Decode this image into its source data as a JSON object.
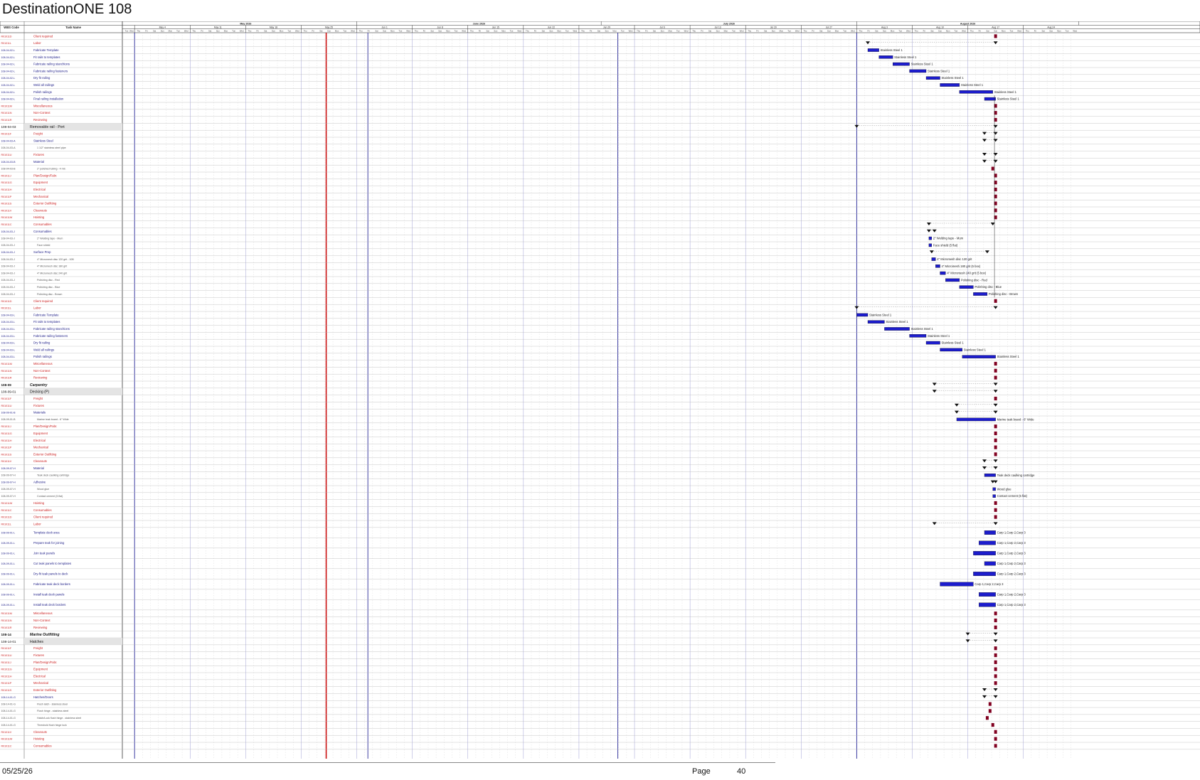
{
  "document": {
    "title": "DestinationONE 108",
    "footer_date": "05/25/26",
    "page_label": "Page",
    "page_number": "40"
  },
  "columns": {
    "wbs": "WBS Code",
    "task": "Task Name"
  },
  "timescale": {
    "months": [
      "May 2026",
      "June 2026",
      "July 2026",
      "August 2026"
    ],
    "weeks": [
      "May 4",
      "May 11",
      "May 18",
      "May 25",
      "Jun 1",
      "Jun 8",
      "Jun 15",
      "Jun 22",
      "Jun 29",
      "Jul 6",
      "Jul 13",
      "Jul 20",
      "Jul 27",
      "Aug 3",
      "Aug 10",
      "Aug 17",
      "Aug 24"
    ],
    "days": [
      "Thu",
      "Fri",
      "Sat",
      "Sun",
      "Mon",
      "Tue",
      "Wed"
    ],
    "today_week_index": 3.45,
    "bar_color": "#1c1ccc",
    "milestone_color": "#800020",
    "text_red": "#cc2222",
    "text_blue": "#22228a"
  },
  "rows": [
    {
      "wbs": "R01011D",
      "name": "Client required",
      "cls": "r",
      "ind": 1,
      "t": "mile",
      "at": 15.5
    },
    {
      "wbs": "R01011L",
      "name": "Labor",
      "cls": "r",
      "ind": 1,
      "t": "sum",
      "s": 13.2,
      "e": 15.5
    },
    {
      "wbs": "108-04-02-L",
      "name": "Fabricate Template",
      "cls": "b",
      "ind": 1,
      "t": "bar",
      "s": 13.2,
      "e": 13.4,
      "lbl": "Stainless Steel 1"
    },
    {
      "wbs": "108-04-02-L",
      "name": "Fit rails to templates",
      "cls": "b",
      "ind": 1,
      "t": "bar",
      "s": 13.4,
      "e": 13.65,
      "lbl": "Stainless Steel 1"
    },
    {
      "wbs": "108-04-02-L",
      "name": "Fabricate railing stanchions",
      "cls": "b",
      "ind": 1,
      "t": "bar",
      "s": 13.65,
      "e": 13.95,
      "lbl": "Stainless Steel 1"
    },
    {
      "wbs": "108-04-02-L",
      "name": "Fabricate railing fasteners",
      "cls": "b",
      "ind": 1,
      "t": "bar",
      "s": 13.95,
      "e": 14.25,
      "lbl": "Stainless Steel 1"
    },
    {
      "wbs": "108-04-02-L",
      "name": "Dry fit railing",
      "cls": "b",
      "ind": 1,
      "t": "bar",
      "s": 14.25,
      "e": 14.5,
      "lbl": "Stainless Steel 1"
    },
    {
      "wbs": "108-04-02-L",
      "name": "Weld all railings",
      "cls": "b",
      "ind": 1,
      "t": "bar",
      "s": 14.5,
      "e": 14.85,
      "lbl": "Stainless Steel 1"
    },
    {
      "wbs": "108-04-02-L",
      "name": "Polish railings",
      "cls": "b",
      "ind": 1,
      "t": "bar",
      "s": 14.85,
      "e": 15.45,
      "lbl": "Stainless Steel 1"
    },
    {
      "wbs": "108-04-02-L",
      "name": "Final railing installation",
      "cls": "b",
      "ind": 1,
      "t": "bar",
      "s": 15.3,
      "e": 15.5,
      "lbl": "Stainless Steel 1"
    },
    {
      "wbs": "R01011M",
      "name": "Miscellaneous",
      "cls": "r",
      "ind": 1,
      "t": "mile",
      "at": 15.5
    },
    {
      "wbs": "R01011N",
      "name": "Non-Context",
      "cls": "r",
      "ind": 1,
      "t": "mile",
      "at": 15.5
    },
    {
      "wbs": "R01011R",
      "name": "Reviewing",
      "cls": "r",
      "ind": 1,
      "t": "mile",
      "at": 15.5
    },
    {
      "wbs": "108-04-03",
      "name": "Removable rail - Port",
      "cls": "h",
      "ind": 0,
      "t": "sum",
      "s": 13.0,
      "e": 15.5
    },
    {
      "wbs": "R01011F",
      "name": "Freight",
      "cls": "r",
      "ind": 1,
      "t": "sum",
      "s": 15.3,
      "e": 15.5
    },
    {
      "wbs": "108-04-03-A",
      "name": "Stainless Steel",
      "cls": "b",
      "ind": 1,
      "t": "sum",
      "s": 15.3,
      "e": 15.5
    },
    {
      "wbs": "108-04-03-A",
      "name": "1 1/2\" stainless steel pipe",
      "cls": "g",
      "ind": 2,
      "t": "none"
    },
    {
      "wbs": "R01011U",
      "name": "Fixtures",
      "cls": "r",
      "ind": 1,
      "t": "sum",
      "s": 15.3,
      "e": 15.5
    },
    {
      "wbs": "108-04-03-B",
      "name": "Material",
      "cls": "b",
      "ind": 1,
      "t": "sum",
      "s": 15.3,
      "e": 15.5
    },
    {
      "wbs": "108-04-03-B",
      "name": "2\" polished tubing - 4 mtr.",
      "cls": "g",
      "ind": 2,
      "t": "mile",
      "at": 15.45
    },
    {
      "wbs": "R01011J",
      "name": "Plan/Design/Fabr.",
      "cls": "r",
      "ind": 1,
      "t": "mile",
      "at": 15.5
    },
    {
      "wbs": "R01011G",
      "name": "Equipment",
      "cls": "r",
      "ind": 1,
      "t": "mile",
      "at": 15.5
    },
    {
      "wbs": "R01011H",
      "name": "Electrical",
      "cls": "r",
      "ind": 1,
      "t": "mile",
      "at": 15.5
    },
    {
      "wbs": "R01011P",
      "name": "Mechanical",
      "cls": "r",
      "ind": 1,
      "t": "mile",
      "at": 15.5
    },
    {
      "wbs": "R01011S",
      "name": "Exterior Outfitting",
      "cls": "r",
      "ind": 1,
      "t": "mile",
      "at": 15.5
    },
    {
      "wbs": "R01011V",
      "name": "Cleanouts",
      "cls": "r",
      "ind": 1,
      "t": "mile",
      "at": 15.5
    },
    {
      "wbs": "R01011W",
      "name": "Hoisting",
      "cls": "r",
      "ind": 1,
      "t": "mile",
      "at": 15.5
    },
    {
      "wbs": "R01011C",
      "name": "Consumables",
      "cls": "r",
      "ind": 1,
      "t": "sum",
      "s": 14.3,
      "e": 15.45
    },
    {
      "wbs": "108-04-03-J",
      "name": "Consumables",
      "cls": "b",
      "ind": 1,
      "t": "sum",
      "s": 14.3,
      "e": 14.4
    },
    {
      "wbs": "108-04-03-J",
      "name": "2\" Welding tape - Mum",
      "cls": "g",
      "ind": 2,
      "t": "bar",
      "s": 14.3,
      "e": 14.35,
      "lbl": "2\" Welding tape - Mum"
    },
    {
      "wbs": "108-04-03-J",
      "name": "Face shield",
      "cls": "g",
      "ind": 2,
      "t": "bar",
      "s": 14.3,
      "e": 14.35,
      "lbl": "Face shield (5 flat)"
    },
    {
      "wbs": "108-04-03-J",
      "name": "Surface Prep",
      "cls": "b",
      "ind": 1,
      "t": "sum",
      "s": 14.35,
      "e": 15.35
    },
    {
      "wbs": "108-04-03-J",
      "name": "4\" Micromesh disc 120 grit - 10B",
      "cls": "g",
      "ind": 2,
      "t": "bar",
      "s": 14.35,
      "e": 14.42,
      "lbl": "4\" Micromesh disc 120 grit"
    },
    {
      "wbs": "108-04-03-J",
      "name": "4\" Micromesh disc 180 grit",
      "cls": "g",
      "ind": 2,
      "t": "bar",
      "s": 14.42,
      "e": 14.5,
      "lbl": "4\" Micromesh 180 grit (5 box)"
    },
    {
      "wbs": "108-04-03-J",
      "name": "4\" Micromesh disc 240 grit",
      "cls": "g",
      "ind": 2,
      "t": "bar",
      "s": 14.5,
      "e": 14.6,
      "lbl": "4\" Micromesh 240 grit (5 box)"
    },
    {
      "wbs": "108-04-03-J",
      "name": "Polishing disc - Red",
      "cls": "g",
      "ind": 2,
      "t": "bar",
      "s": 14.6,
      "e": 14.85,
      "lbl": "Polishing disc - Red"
    },
    {
      "wbs": "108-04-03-J",
      "name": "Polishing disc - Blue",
      "cls": "g",
      "ind": 2,
      "t": "bar",
      "s": 14.85,
      "e": 15.1,
      "lbl": "Polishing disc - Blue"
    },
    {
      "wbs": "108-04-03-J",
      "name": "Polishing disc - Brown",
      "cls": "g",
      "ind": 2,
      "t": "bar",
      "s": 15.1,
      "e": 15.35,
      "lbl": "Polishing disc - Brown"
    },
    {
      "wbs": "R01011D",
      "name": "Client required",
      "cls": "r",
      "ind": 1,
      "t": "mile",
      "at": 15.5
    },
    {
      "wbs": "R01011L",
      "name": "Labor",
      "cls": "r",
      "ind": 1,
      "t": "sum",
      "s": 13.0,
      "e": 15.5
    },
    {
      "wbs": "108-04-03-L",
      "name": "Fabricate Template",
      "cls": "b",
      "ind": 1,
      "t": "bar",
      "s": 13.0,
      "e": 13.2,
      "lbl": "Stainless Steel 1"
    },
    {
      "wbs": "108-04-03-L",
      "name": "Fit rails to templates",
      "cls": "b",
      "ind": 1,
      "t": "bar",
      "s": 13.2,
      "e": 13.5,
      "lbl": "Stainless Steel 1"
    },
    {
      "wbs": "108-04-03-L",
      "name": "Fabricate railing stanchions",
      "cls": "b",
      "ind": 1,
      "t": "bar",
      "s": 13.5,
      "e": 13.95,
      "lbl": "Stainless Steel 1"
    },
    {
      "wbs": "108-04-03-L",
      "name": "Fabricate railing fasteners",
      "cls": "b",
      "ind": 1,
      "t": "bar",
      "s": 13.95,
      "e": 14.25,
      "lbl": "Stainless Steel 1"
    },
    {
      "wbs": "108-04-03-L",
      "name": "Dry fit railing",
      "cls": "b",
      "ind": 1,
      "t": "bar",
      "s": 14.25,
      "e": 14.5,
      "lbl": "Stainless Steel 1"
    },
    {
      "wbs": "108-04-03-L",
      "name": "Weld all railings",
      "cls": "b",
      "ind": 1,
      "t": "bar",
      "s": 14.5,
      "e": 14.9,
      "lbl": "Stainless Steel 1"
    },
    {
      "wbs": "108-04-03-L",
      "name": "Polish railings",
      "cls": "b",
      "ind": 1,
      "t": "bar",
      "s": 14.9,
      "e": 15.5,
      "lbl": "Stainless Steel 1"
    },
    {
      "wbs": "R01011M",
      "name": "Miscellaneous",
      "cls": "r",
      "ind": 1,
      "t": "mile",
      "at": 15.5
    },
    {
      "wbs": "R01011N",
      "name": "Non-Context",
      "cls": "r",
      "ind": 1,
      "t": "mile",
      "at": 15.5
    },
    {
      "wbs": "R01011R",
      "name": "Reviewing",
      "cls": "r",
      "ind": 1,
      "t": "mile",
      "at": 15.5
    },
    {
      "wbs": "108-09",
      "name": "Carpentry",
      "cls": "hb",
      "ind": 0,
      "t": "sum",
      "s": 14.4,
      "e": 15.5
    },
    {
      "wbs": "108-09-01",
      "name": "Decking (P)",
      "cls": "h",
      "ind": 0,
      "t": "sum",
      "s": 14.4,
      "e": 15.5
    },
    {
      "wbs": "R01011F",
      "name": "Freight",
      "cls": "r",
      "ind": 1,
      "t": "mile",
      "at": 15.5
    },
    {
      "wbs": "R01011U",
      "name": "Fixtures",
      "cls": "r",
      "ind": 1,
      "t": "sum",
      "s": 14.8,
      "e": 15.5
    },
    {
      "wbs": "108-09-01-B",
      "name": "Materials",
      "cls": "b",
      "ind": 1,
      "t": "sum",
      "s": 14.8,
      "e": 15.5
    },
    {
      "wbs": "108-09-01-B",
      "name": "Marine teak board - 6\" Wide",
      "cls": "g",
      "ind": 2,
      "t": "bar",
      "s": 14.8,
      "e": 15.5,
      "lbl": "Marine teak board - 6\" Wide"
    },
    {
      "wbs": "R01011J",
      "name": "Plan/Design/Fabr.",
      "cls": "r",
      "ind": 1,
      "t": "mile",
      "at": 15.5
    },
    {
      "wbs": "R01011G",
      "name": "Equipment",
      "cls": "r",
      "ind": 1,
      "t": "mile",
      "at": 15.5
    },
    {
      "wbs": "R01011H",
      "name": "Electrical",
      "cls": "r",
      "ind": 1,
      "t": "mile",
      "at": 15.5
    },
    {
      "wbs": "R01011P",
      "name": "Mechanical",
      "cls": "r",
      "ind": 1,
      "t": "mile",
      "at": 15.5
    },
    {
      "wbs": "R01011S",
      "name": "Exterior Outfitting",
      "cls": "r",
      "ind": 1,
      "t": "mile",
      "at": 15.5
    },
    {
      "wbs": "R01011V",
      "name": "Cleanouts",
      "cls": "r",
      "ind": 1,
      "t": "sum",
      "s": 15.3,
      "e": 15.5
    },
    {
      "wbs": "108-09-07-H",
      "name": "Material",
      "cls": "b",
      "ind": 1,
      "t": "sum",
      "s": 15.3,
      "e": 15.5
    },
    {
      "wbs": "108-09-07-H",
      "name": "Teak deck caulking cartridge",
      "cls": "g",
      "ind": 2,
      "t": "bar",
      "s": 15.3,
      "e": 15.5,
      "lbl": "Teak deck caulking cartridge"
    },
    {
      "wbs": "108-09-07-H",
      "name": "Adhesive",
      "cls": "b",
      "ind": 1,
      "t": "sum",
      "s": 15.45,
      "e": 15.5
    },
    {
      "wbs": "108-09-07-H",
      "name": "Wood glue",
      "cls": "g",
      "ind": 2,
      "t": "bar",
      "s": 15.45,
      "e": 15.5,
      "lbl": "Wood glue"
    },
    {
      "wbs": "108-09-07-H",
      "name": "Contact cement (5 flat)",
      "cls": "g",
      "ind": 2,
      "t": "bar",
      "s": 15.45,
      "e": 15.5,
      "lbl": "Contact cement (5 flat)"
    },
    {
      "wbs": "R01011W",
      "name": "Hoisting",
      "cls": "r",
      "ind": 1,
      "t": "mile",
      "at": 15.5
    },
    {
      "wbs": "R01011C",
      "name": "Consumables",
      "cls": "r",
      "ind": 1,
      "t": "mile",
      "at": 15.5
    },
    {
      "wbs": "R01011D",
      "name": "Client required",
      "cls": "r",
      "ind": 1,
      "t": "mile",
      "at": 15.5
    },
    {
      "wbs": "R01011L",
      "name": "Labor",
      "cls": "r",
      "ind": 1,
      "t": "sum",
      "s": 14.4,
      "e": 15.5
    },
    {
      "wbs": "108-09-01-L",
      "name": "Template deck area",
      "cls": "b",
      "ind": 1,
      "t": "bar",
      "s": 15.3,
      "e": 15.5,
      "lbl": "Carp 1,Carp 2,Carp 3",
      "tall": 1
    },
    {
      "wbs": "108-09-01-L",
      "name": "Prepare teak for joining",
      "cls": "b",
      "ind": 1,
      "t": "bar",
      "s": 15.2,
      "e": 15.5,
      "lbl": "Carp 1,Carp 2,Carp 3",
      "tall": 1
    },
    {
      "wbs": "108-09-01-L",
      "name": "Join teak panels",
      "cls": "b",
      "ind": 1,
      "t": "bar",
      "s": 15.1,
      "e": 15.5,
      "lbl": "Carp 1,Carp 2,Carp 3",
      "tall": 1
    },
    {
      "wbs": "108-09-01-L",
      "name": "Cut teak panels to templates",
      "cls": "b",
      "ind": 1,
      "t": "bar",
      "s": 15.3,
      "e": 15.5,
      "lbl": "Carp 1,Carp 2,Carp 3",
      "tall": 1
    },
    {
      "wbs": "108-09-01-L",
      "name": "Dry-fit teak panels to deck",
      "cls": "b",
      "ind": 1,
      "t": "bar",
      "s": 15.1,
      "e": 15.5,
      "lbl": "Carp 1,Carp 2,Carp 3",
      "tall": 1
    },
    {
      "wbs": "108-09-01-L",
      "name": "Fabricate teak deck borders",
      "cls": "b",
      "ind": 1,
      "t": "bar",
      "s": 14.5,
      "e": 15.1,
      "lbl": "Carp 1,Carp 2,Carp 3",
      "tall": 1
    },
    {
      "wbs": "108-09-01-L",
      "name": "Install teak deck panels",
      "cls": "b",
      "ind": 1,
      "t": "bar",
      "s": 15.2,
      "e": 15.5,
      "lbl": "Carp 1,Carp 2,Carp 3",
      "tall": 1
    },
    {
      "wbs": "108-09-01-L",
      "name": "Install teak deck borders",
      "cls": "b",
      "ind": 1,
      "t": "bar",
      "s": 15.2,
      "e": 15.5,
      "lbl": "Carp 1,Carp 2,Carp 3",
      "tall": 1
    },
    {
      "wbs": "R01011M",
      "name": "Miscellaneous",
      "cls": "r",
      "ind": 1,
      "t": "mile",
      "at": 15.5
    },
    {
      "wbs": "R01011N",
      "name": "Non-Context",
      "cls": "r",
      "ind": 1,
      "t": "mile",
      "at": 15.5
    },
    {
      "wbs": "R01011R",
      "name": "Reviewing",
      "cls": "r",
      "ind": 1,
      "t": "mile",
      "at": 15.5
    },
    {
      "wbs": "108-14",
      "name": "Marine Outfitting",
      "cls": "hb",
      "ind": 0,
      "t": "sum",
      "s": 15.0,
      "e": 15.5
    },
    {
      "wbs": "108-14-01",
      "name": "Hatches",
      "cls": "h",
      "ind": 0,
      "t": "sum",
      "s": 15.0,
      "e": 15.5
    },
    {
      "wbs": "R01011F",
      "name": "Freight",
      "cls": "r",
      "ind": 1,
      "t": "mile",
      "at": 15.5
    },
    {
      "wbs": "R01011U",
      "name": "Fixtures",
      "cls": "r",
      "ind": 1,
      "t": "mile",
      "at": 15.5
    },
    {
      "wbs": "R01011J",
      "name": "Plan/Design/Fabr.",
      "cls": "r",
      "ind": 1,
      "t": "mile",
      "at": 15.5
    },
    {
      "wbs": "R01011G",
      "name": "Equipment",
      "cls": "r",
      "ind": 1,
      "t": "mile",
      "at": 15.5
    },
    {
      "wbs": "R01011H",
      "name": "Electrical",
      "cls": "r",
      "ind": 1,
      "t": "mile",
      "at": 15.5
    },
    {
      "wbs": "R01011P",
      "name": "Mechanical",
      "cls": "r",
      "ind": 1,
      "t": "mile",
      "at": 15.5
    },
    {
      "wbs": "R01011S",
      "name": "Exterior Outfitting",
      "cls": "r",
      "ind": 1,
      "t": "sum",
      "s": 15.3,
      "e": 15.5
    },
    {
      "wbs": "108-14-01-G",
      "name": "Hatches/Doors",
      "cls": "b",
      "ind": 1,
      "t": "sum",
      "s": 15.3,
      "e": 15.5
    },
    {
      "wbs": "108-14-01-G",
      "name": "Flush latch - stainless steel",
      "cls": "g",
      "ind": 2,
      "t": "mile",
      "at": 15.4
    },
    {
      "wbs": "108-14-01-G",
      "name": "Flush hinge - stainless steel",
      "cls": "g",
      "ind": 2,
      "t": "mile",
      "at": 15.4
    },
    {
      "wbs": "108-14-01-G",
      "name": "Hatch/Lock flush hinge - stainless steel",
      "cls": "g",
      "ind": 2,
      "t": "mile",
      "at": 15.35
    },
    {
      "wbs": "108-14-01-G",
      "name": "Threshold flush hinge lock",
      "cls": "g",
      "ind": 2,
      "t": "mile",
      "at": 15.45
    },
    {
      "wbs": "R01011V",
      "name": "Cleanouts",
      "cls": "r",
      "ind": 1,
      "t": "mile",
      "at": 15.5
    },
    {
      "wbs": "R01011W",
      "name": "Hoisting",
      "cls": "r",
      "ind": 1,
      "t": "mile",
      "at": 15.5
    },
    {
      "wbs": "R01011C",
      "name": "Consumables",
      "cls": "r",
      "ind": 1,
      "t": "mile",
      "at": 15.5
    }
  ]
}
